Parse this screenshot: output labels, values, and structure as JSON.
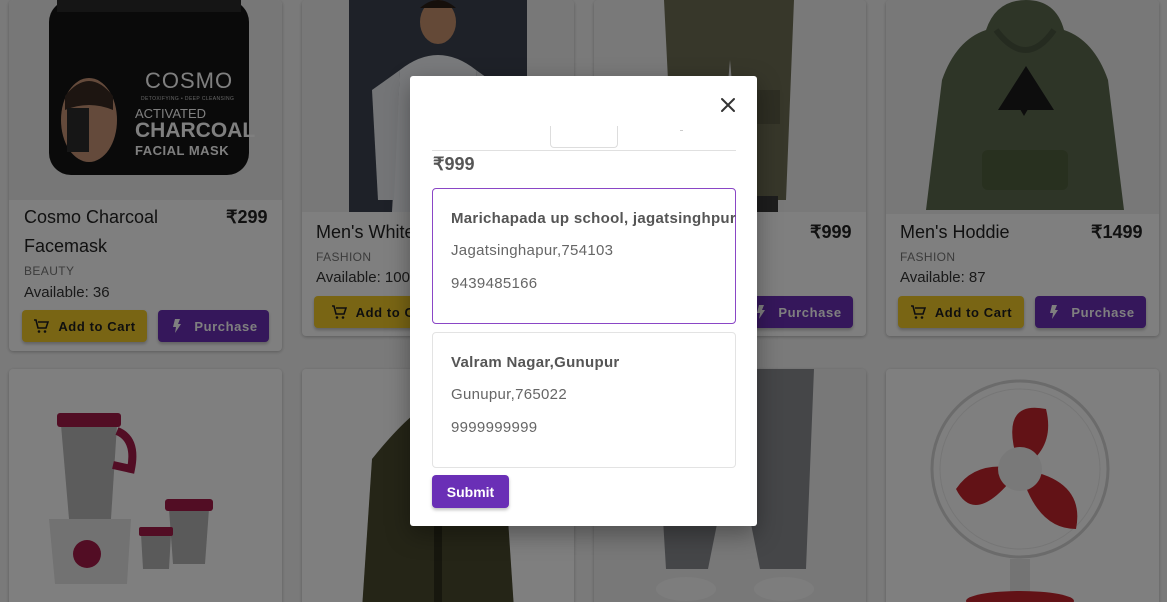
{
  "products": [
    {
      "name": "Cosmo Charcoal Facemask",
      "price": "₹299",
      "category": "BEAUTY",
      "available": "Available: 36",
      "add_to_cart": "Add to Cart",
      "purchase": "Purchase"
    },
    {
      "name": "Men's White",
      "price": "",
      "category": "FASHION",
      "available": "Available: 100",
      "add_to_cart": "Add to Ca",
      "purchase": ""
    },
    {
      "name": "",
      "price": "₹999",
      "category": "",
      "available": "",
      "add_to_cart": "",
      "purchase": "Purchase"
    },
    {
      "name": "Men's Hoddie",
      "price": "₹1499",
      "category": "FASHION",
      "available": "Available: 87",
      "add_to_cart": "Add to Cart",
      "purchase": "Purchase"
    }
  ],
  "product_images": {
    "jar_brand": "COSMO",
    "jar_tagline": "DETOXIFYING • DEEP CLEANSING",
    "jar_line1": "ACTIVATED",
    "jar_line2": "CHARCOAL",
    "jar_line3": "FACIAL MASK"
  },
  "modal": {
    "price": "₹999",
    "addresses": [
      {
        "line1": "Marichapada up school, jagatsinghpur",
        "line2": "Jagatsinghapur,754103",
        "phone": "9439485166",
        "selected": true
      },
      {
        "line1": "Valram Nagar,Gunupur",
        "line2": "Gunupur,765022",
        "phone": "9999999999",
        "selected": false
      }
    ],
    "submit_label": "Submit",
    "close_icon": "close-icon"
  },
  "colors": {
    "purchase": "#6a2fb6",
    "add_to_cart": "#f2cb29",
    "selected_border": "#8a46c6"
  }
}
